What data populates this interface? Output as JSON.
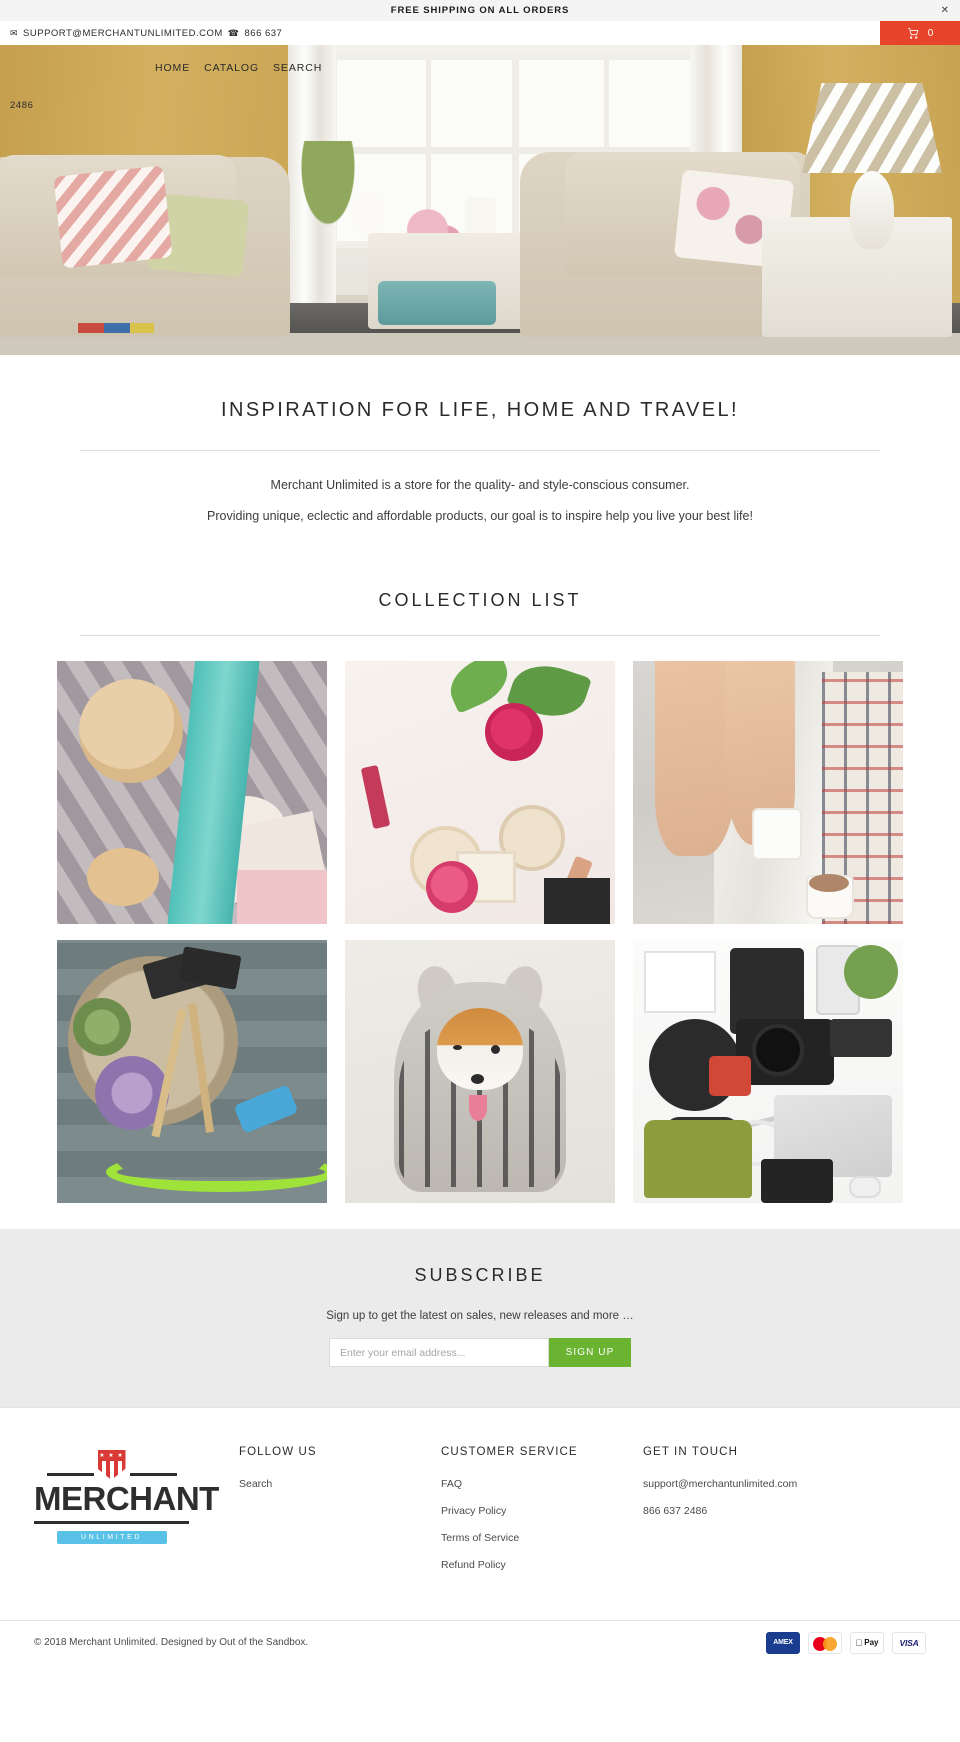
{
  "announcement": {
    "text": "FREE SHIPPING ON ALL ORDERS",
    "close_label": "✕"
  },
  "utility": {
    "email": "SUPPORT@MERCHANTUNLIMITED.COM",
    "email_icon": "envelope-icon",
    "phone_icon": "telephone-icon",
    "phone": "866 637",
    "phone_wrap": "2486",
    "cart_icon": "shopping-cart-icon",
    "cart_count": "0"
  },
  "nav": {
    "items": [
      {
        "label": "HOME"
      },
      {
        "label": "CATALOG"
      },
      {
        "label": "SEARCH"
      }
    ]
  },
  "richtext": {
    "heading": "INSPIRATION FOR LIFE, HOME AND TRAVEL!",
    "paragraph1": "Merchant Unlimited is a store for the quality- and style-conscious consumer.",
    "paragraph2": "Providing unique, eclectic and affordable products, our goal is to inspire help you live your best life!"
  },
  "collections": {
    "heading": "COLLECTION LIST",
    "tiles": [
      {
        "name": "jewelry-and-knitwear-flatlay"
      },
      {
        "name": "makeup-and-flowers-flatlay"
      },
      {
        "name": "coffee-in-bed-lifestyle"
      },
      {
        "name": "succulents-and-garden-tools"
      },
      {
        "name": "corgi-in-pet-bed"
      },
      {
        "name": "desk-tech-flatlay"
      }
    ]
  },
  "subscribe": {
    "heading": "SUBSCRIBE",
    "tagline": "Sign up to get the latest on sales, new releases and more …",
    "input_placeholder": "Enter your email address...",
    "input_value": "",
    "button_label": "SIGN UP",
    "button_color": "#6ab432"
  },
  "footer": {
    "logo": {
      "word": "MERCHANT",
      "sub": "UNLIMITED",
      "stars": "★ ★ ★",
      "sub_color": "#5bc2e7",
      "shield_color": "#d93a36"
    },
    "columns": [
      {
        "title": "FOLLOW US",
        "links": [
          {
            "label": "Search"
          }
        ]
      },
      {
        "title": "CUSTOMER SERVICE",
        "links": [
          {
            "label": "FAQ"
          },
          {
            "label": "Privacy Policy"
          },
          {
            "label": "Terms of Service"
          },
          {
            "label": "Refund Policy"
          }
        ]
      },
      {
        "title": "GET IN TOUCH",
        "links": [
          {
            "label": "support@merchantunlimited.com"
          },
          {
            "label": "866 637 2486"
          }
        ]
      }
    ],
    "copyright": "© 2018 Merchant Unlimited. Designed by Out of the Sandbox.",
    "payments": [
      {
        "name": "amex",
        "label": "AMEX"
      },
      {
        "name": "mastercard",
        "label": ""
      },
      {
        "name": "apple-pay",
        "label": "Pay"
      },
      {
        "name": "visa",
        "label": "VISA"
      }
    ]
  },
  "colors": {
    "cart_red": "#e8432b",
    "subscribe_bg": "#ebebeb",
    "signup_green": "#6ab432"
  }
}
